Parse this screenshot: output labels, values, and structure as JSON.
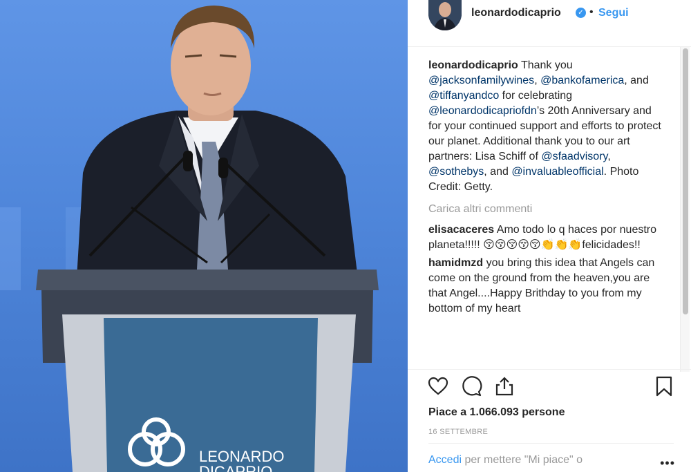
{
  "post": {
    "username": "leonardodicaprio",
    "follow_label": "Segui",
    "separator": "•",
    "verified_icon": "✓",
    "podium_logo_text": [
      "LEONARDO",
      "DICAPRIO"
    ]
  },
  "caption": {
    "username": "leonardodicaprio",
    "segments": [
      {
        "type": "text",
        "value": " Thank you "
      },
      {
        "type": "mention",
        "value": "@jacksonfamilywines"
      },
      {
        "type": "text",
        "value": ", "
      },
      {
        "type": "mention",
        "value": "@bankofamerica"
      },
      {
        "type": "text",
        "value": ", and "
      },
      {
        "type": "mention",
        "value": "@tiffanyandco"
      },
      {
        "type": "text",
        "value": " for celebrating "
      },
      {
        "type": "mention",
        "value": "@leonardodicapriofdn"
      },
      {
        "type": "text",
        "value": "’s 20th Anniversary and for your continued support and efforts to protect our planet. Additional thank you to our art partners: Lisa Schiff of "
      },
      {
        "type": "mention",
        "value": "@sfaadvisory"
      },
      {
        "type": "text",
        "value": ", "
      },
      {
        "type": "mention",
        "value": "@sothebys"
      },
      {
        "type": "text",
        "value": ", and "
      },
      {
        "type": "mention",
        "value": "@invaluableofficial"
      },
      {
        "type": "text",
        "value": ". Photo Credit: Getty."
      }
    ]
  },
  "load_more_label": "Carica altri commenti",
  "comments": [
    {
      "username": "elisacaceres",
      "text": " Amo todo lo q haces por nuestro planeta!!!!! 😚😚😚😚😚👏👏👏felicidades!!"
    },
    {
      "username": "hamidmzd",
      "text": " you bring this idea that Angels can come on the ground from the heaven,you are that Angel....Happy Brithday to you from my bottom of my heart"
    }
  ],
  "actions": {
    "like_icon": "heart-icon",
    "comment_icon": "comment-icon",
    "share_icon": "share-icon",
    "save_icon": "bookmark-icon"
  },
  "likes_text": "Piace a 1.066.093 persone",
  "date_text": "16 SETTEMBRE",
  "footer": {
    "login_label": "Accedi",
    "login_rest": " per mettere \"Mi piace\" o",
    "more_label": "•••"
  },
  "colors": {
    "accent": "#3897f0",
    "mention": "#003569",
    "muted": "#999999",
    "text": "#262626",
    "photo_bg": "#4f86da"
  }
}
